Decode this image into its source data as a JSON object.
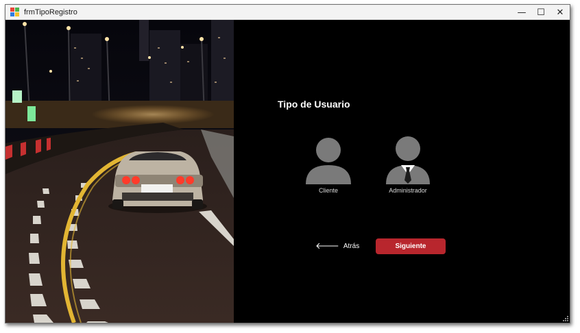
{
  "window": {
    "title": "frmTipoRegistro",
    "controls": {
      "minimize": "—",
      "maximize": "☐",
      "close": "✕"
    }
  },
  "form": {
    "heading": "Tipo de Usuario",
    "options": [
      {
        "label": "Cliente",
        "icon": "user-icon"
      },
      {
        "label": "Administrador",
        "icon": "admin-user-icon"
      }
    ],
    "back": {
      "arrow": "🡐",
      "label": "Atrás"
    },
    "next": {
      "label": "Siguiente"
    }
  },
  "colors": {
    "background": "#000000",
    "accent": "#b8262d",
    "icon_gray": "#7a7a7a"
  }
}
